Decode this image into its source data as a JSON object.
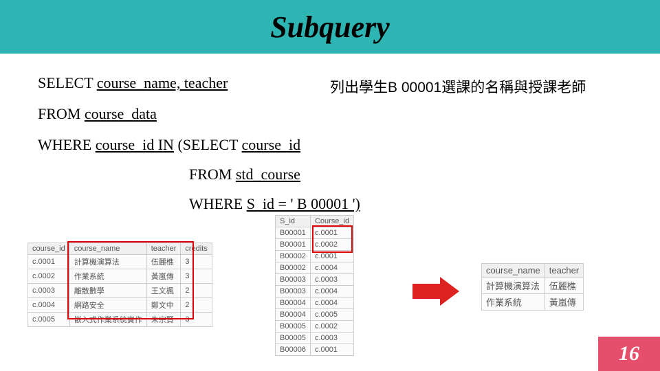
{
  "title": "Subquery",
  "description": "列出學生B 00001選課的名稱與授課老師",
  "sql": {
    "l1a": "SELECT",
    "l1b": "course_name, teacher",
    "l2a": "FROM",
    "l2b": "course_data",
    "l3a": "WHERE",
    "l3b": "course_id  IN",
    "l3c": "(SELECT",
    "l3d": "course_id",
    "l4a": "FROM",
    "l4b": "std_course",
    "l5a": "WHERE",
    "l5b": "S_id =  ' B 00001 ')"
  },
  "table_course": {
    "headers": [
      "course_id",
      "course_name",
      "teacher",
      "credits"
    ],
    "rows": [
      [
        "c.0001",
        "計算機演算法",
        "伍麗樵",
        "3"
      ],
      [
        "c.0002",
        "作業系統",
        "黃嵐傳",
        "3"
      ],
      [
        "c.0003",
        "離散數學",
        "王文楓",
        "2"
      ],
      [
        "c.0004",
        "網路安全",
        "鄭文中",
        "2"
      ],
      [
        "c.0005",
        "嵌入式作業系統實作",
        "朱宗賢",
        "3"
      ]
    ]
  },
  "table_std": {
    "headers": [
      "S_id",
      "Course_id"
    ],
    "rows": [
      [
        "B00001",
        "c.0001"
      ],
      [
        "B00001",
        "c.0002"
      ],
      [
        "B00002",
        "c.0001"
      ],
      [
        "B00002",
        "c.0004"
      ],
      [
        "B00003",
        "c.0003"
      ],
      [
        "B00003",
        "c.0004"
      ],
      [
        "B00004",
        "c.0004"
      ],
      [
        "B00004",
        "c.0005"
      ],
      [
        "B00005",
        "c.0002"
      ],
      [
        "B00005",
        "c.0003"
      ],
      [
        "B00006",
        "c.0001"
      ]
    ]
  },
  "table_result": {
    "headers": [
      "course_name",
      "teacher"
    ],
    "rows": [
      [
        "計算機演算法",
        "伍麗樵"
      ],
      [
        "作業系統",
        "黃嵐傳"
      ]
    ]
  },
  "page_number": "16"
}
